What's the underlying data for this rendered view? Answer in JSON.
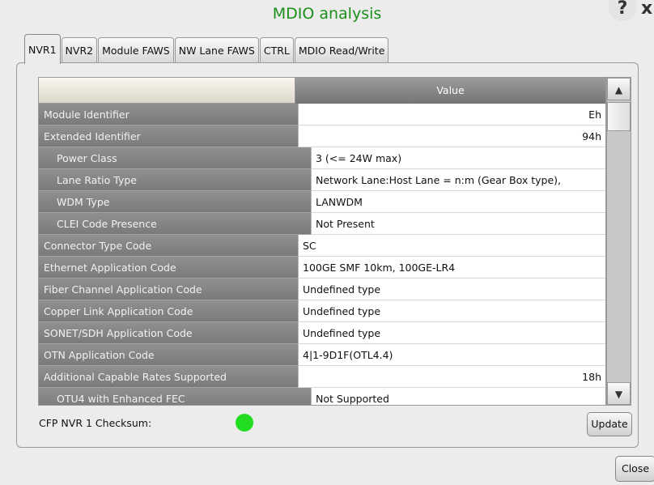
{
  "window": {
    "title": "MDIO analysis",
    "help_label": "?",
    "close_label": "x"
  },
  "tabs": [
    {
      "label": "NVR1",
      "active": true
    },
    {
      "label": "NVR2",
      "active": false
    },
    {
      "label": "Module FAWS",
      "active": false
    },
    {
      "label": "NW Lane FAWS",
      "active": false
    },
    {
      "label": "CTRL",
      "active": false
    },
    {
      "label": "MDIO Read/Write",
      "active": false
    }
  ],
  "table": {
    "headers": {
      "name": "",
      "value": "Value"
    },
    "rows": [
      {
        "name": "Module Identifier",
        "value": "Eh",
        "sub": false,
        "right": true
      },
      {
        "name": "Extended Identifier",
        "value": "94h",
        "sub": false,
        "right": true
      },
      {
        "name": "Power Class",
        "value": "3 (<= 24W max)",
        "sub": true,
        "right": false
      },
      {
        "name": "Lane Ratio Type",
        "value": "Network Lane:Host Lane = n:m (Gear Box type),",
        "sub": true,
        "right": false
      },
      {
        "name": "WDM Type",
        "value": "LANWDM",
        "sub": true,
        "right": false
      },
      {
        "name": "CLEI Code Presence",
        "value": "Not Present",
        "sub": true,
        "right": false
      },
      {
        "name": "Connector Type Code",
        "value": "SC",
        "sub": false,
        "right": false
      },
      {
        "name": "Ethernet Application Code",
        "value": "100GE SMF 10km, 100GE-LR4",
        "sub": false,
        "right": false
      },
      {
        "name": "Fiber Channel Application Code",
        "value": "Undefined type",
        "sub": false,
        "right": false
      },
      {
        "name": "Copper Link Application Code",
        "value": "Undefined type",
        "sub": false,
        "right": false
      },
      {
        "name": "SONET/SDH Application Code",
        "value": "Undefined type",
        "sub": false,
        "right": false
      },
      {
        "name": "OTN Application Code",
        "value": "4|1-9D1F(OTL4.4)",
        "sub": false,
        "right": false
      },
      {
        "name": "Additional Capable Rates Supported",
        "value": "18h",
        "sub": false,
        "right": true
      },
      {
        "name": "OTU4 with Enhanced FEC",
        "value": "Not Supported",
        "sub": true,
        "right": false
      }
    ]
  },
  "scrollbar": {
    "up_icon": "triangle-up-icon",
    "down_icon": "triangle-down-icon"
  },
  "checksum": {
    "label": "CFP NVR 1 Checksum:",
    "status_color": "#22dd22"
  },
  "buttons": {
    "update": "Update",
    "close": "Close"
  }
}
